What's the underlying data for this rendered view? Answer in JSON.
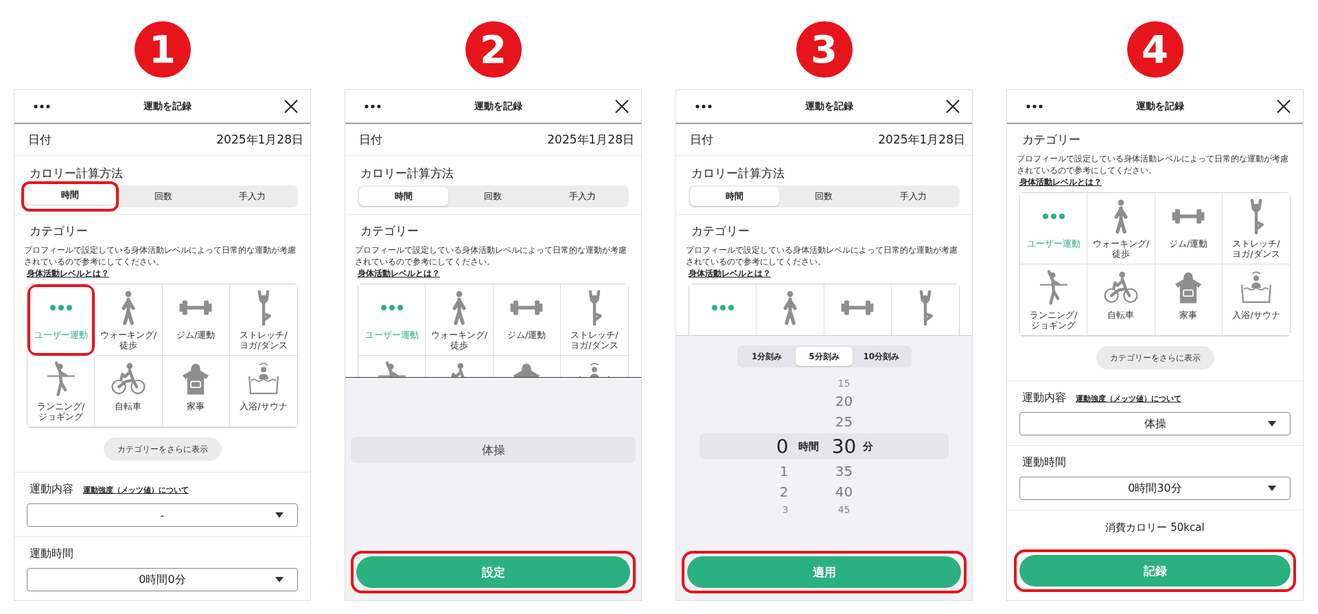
{
  "steps": [
    {
      "number": "1",
      "screen": {
        "header": {
          "title": "運動を記録"
        },
        "sections": [
          {
            "kind": "date",
            "label": "日付",
            "value": "2025年1月28日"
          },
          {
            "kind": "calc_method",
            "heading": "カロリー計算方法",
            "tabs": [
              {
                "label": "時間",
                "selected": true,
                "highlighted": true
              },
              {
                "label": "回数",
                "selected": false,
                "highlighted": false
              },
              {
                "label": "手入力",
                "selected": false,
                "highlighted": false
              }
            ]
          },
          {
            "kind": "category",
            "heading": "カテゴリー",
            "description": "プロフィールで設定している身体活動レベルによって日常的な運動が考慮されているので参考にしてください。",
            "link": "身体活動レベルとは？",
            "cells": [
              {
                "label": "ユーザー運動",
                "selected": true,
                "highlighted": true
              },
              {
                "label": "ウォーキング/\n徒歩",
                "selected": false,
                "highlighted": false
              },
              {
                "label": "ジム/運動",
                "selected": false,
                "highlighted": false
              },
              {
                "label": "ストレッチ/\nヨガ/ダンス",
                "selected": false,
                "highlighted": false
              },
              {
                "label": "ランニング/\nジョギング",
                "selected": false,
                "highlighted": false
              },
              {
                "label": "自転車",
                "selected": false,
                "highlighted": false
              },
              {
                "label": "家事",
                "selected": false,
                "highlighted": false
              },
              {
                "label": "入浴/サウナ",
                "selected": false,
                "highlighted": false
              }
            ],
            "more_button": "カテゴリーをさらに表示"
          },
          {
            "kind": "exercise",
            "label": "運動内容",
            "link": "運動強度（メッツ値）について",
            "value": "-"
          },
          {
            "kind": "duration",
            "label": "運動時間",
            "value": "0時間0分"
          }
        ]
      }
    },
    {
      "number": "2",
      "screen": {
        "header": {
          "title": "運動を記録"
        },
        "sections": [
          {
            "kind": "date",
            "label": "日付",
            "value": "2025年1月28日"
          },
          {
            "kind": "calc_method",
            "heading": "カロリー計算方法",
            "tabs": [
              {
                "label": "時間",
                "selected": true,
                "highlighted": false
              },
              {
                "label": "回数",
                "selected": false,
                "highlighted": false
              },
              {
                "label": "手入力",
                "selected": false,
                "highlighted": false
              }
            ]
          },
          {
            "kind": "category",
            "heading": "カテゴリー",
            "description": "プロフィールで設定している身体活動レベルによって日常的な運動が考慮されているので参考にしてください。",
            "link": "身体活動レベルとは？",
            "cells": [
              {
                "label": "ユーザー運動",
                "selected": true,
                "highlighted": false
              },
              {
                "label": "ウォーキング/\n徒歩",
                "selected": false,
                "highlighted": false
              },
              {
                "label": "ジム/運動",
                "selected": false,
                "highlighted": false
              },
              {
                "label": "ストレッチ/\nヨガ/ダンス",
                "selected": false,
                "highlighted": false
              },
              {
                "selected": false,
                "highlighted": false
              },
              {
                "selected": false,
                "highlighted": false
              },
              {
                "selected": false,
                "highlighted": false
              },
              {
                "selected": false,
                "highlighted": false
              }
            ]
          }
        ],
        "sheet": {
          "kind": "list_picker",
          "options": [
            {
              "label": "体操",
              "selected": true
            }
          ]
        },
        "button": {
          "label": "設定",
          "highlighted": true
        }
      }
    },
    {
      "number": "3",
      "screen": {
        "header": {
          "title": "運動を記録"
        },
        "sections": [
          {
            "kind": "date",
            "label": "日付",
            "value": "2025年1月28日"
          },
          {
            "kind": "calc_method",
            "heading": "カロリー計算方法",
            "tabs": [
              {
                "label": "時間",
                "selected": true,
                "highlighted": false
              },
              {
                "label": "回数",
                "selected": false,
                "highlighted": false
              },
              {
                "label": "手入力",
                "selected": false,
                "highlighted": false
              }
            ]
          },
          {
            "kind": "category",
            "heading": "カテゴリー",
            "description": "プロフィールで設定している身体活動レベルによって日常的な運動が考慮されているので参考にしてください。",
            "link": "身体活動レベルとは？",
            "cells": [
              {
                "selected": true,
                "highlighted": false
              },
              {
                "selected": false,
                "highlighted": false
              },
              {
                "selected": false,
                "highlighted": false
              },
              {
                "selected": false,
                "highlighted": false
              }
            ]
          }
        ],
        "sheet": {
          "kind": "time_picker",
          "increments": [
            {
              "label": "1分刻み",
              "selected": false
            },
            {
              "label": "5分刻み",
              "selected": true
            },
            {
              "label": "10分刻み",
              "selected": false
            }
          ],
          "hours": [
            {
              "value": "0",
              "selected": true
            },
            {
              "value": "1",
              "selected": false
            },
            {
              "value": "2",
              "selected": false
            },
            {
              "value": "3",
              "selected": false
            }
          ],
          "minutes": [
            {
              "value": "15",
              "selected": false
            },
            {
              "value": "20",
              "selected": false
            },
            {
              "value": "25",
              "selected": false
            },
            {
              "value": "30",
              "selected": true
            },
            {
              "value": "35",
              "selected": false
            },
            {
              "value": "40",
              "selected": false
            },
            {
              "value": "45",
              "selected": false
            }
          ],
          "hour_unit": "時間",
          "minute_unit": "分"
        },
        "button": {
          "label": "適用",
          "highlighted": true
        }
      }
    },
    {
      "number": "4",
      "screen": {
        "header": {
          "title": "運動を記録"
        },
        "sections": [
          {
            "kind": "category",
            "heading": "カテゴリー",
            "description": "プロフィールで設定している身体活動レベルによって日常的な運動が考慮されているので参考にしてください。",
            "link": "身体活動レベルとは？",
            "cells": [
              {
                "label": "ユーザー運動",
                "selected": true,
                "highlighted": false
              },
              {
                "label": "ウォーキング/\n徒歩",
                "selected": false,
                "highlighted": false
              },
              {
                "label": "ジム/運動",
                "selected": false,
                "highlighted": false
              },
              {
                "label": "ストレッチ/\nヨガ/ダンス",
                "selected": false,
                "highlighted": false
              },
              {
                "label": "ランニング/\nジョギング",
                "selected": false,
                "highlighted": false
              },
              {
                "label": "自転車",
                "selected": false,
                "highlighted": false
              },
              {
                "label": "家事",
                "selected": false,
                "highlighted": false
              },
              {
                "label": "入浴/サウナ",
                "selected": false,
                "highlighted": false
              }
            ],
            "more_button": "カテゴリーをさらに表示"
          },
          {
            "kind": "exercise",
            "label": "運動内容",
            "link": "運動強度（メッツ値）について",
            "value": "体操"
          },
          {
            "kind": "duration",
            "label": "運動時間",
            "value": "0時間30分"
          },
          {
            "kind": "calories",
            "text": "消費カロリー 50kcal"
          }
        ],
        "button": {
          "label": "記録",
          "highlighted": true
        }
      }
    }
  ]
}
